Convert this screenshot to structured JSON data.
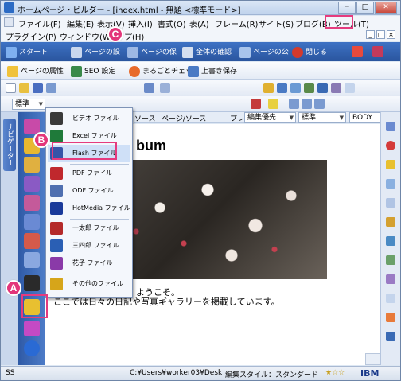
{
  "titlebar": {
    "title": "ホームページ・ビルダー - [index.html - 無題 <標準モード>]",
    "min": "─",
    "max": "□",
    "close": "✕"
  },
  "menu": {
    "row1": [
      "ファイル(F)",
      "編集(E)",
      "表示(V)",
      "挿入(I)",
      "書式(O)",
      "表(A)",
      "フレーム(R)",
      "サイト(S)",
      "ブログ(B)",
      "ツール(T)"
    ],
    "row2": [
      "プラグイン(P)",
      "ウィンドウ(W)",
      "プ(H)"
    ]
  },
  "mdi": [
    "_",
    "□",
    "×"
  ],
  "toolbar1": [
    "スタート",
    "ページの設",
    "ページの保",
    "全体の確認",
    "ページの公",
    "閉じる"
  ],
  "toolbar2": [
    "ページの属性",
    "SEO 設定",
    "まるごとチェック",
    "上書き保存"
  ],
  "toolbar3": {
    "style": "標準"
  },
  "format": {
    "bold": "B",
    "italic": "I",
    "strike": "S",
    "underline": "U"
  },
  "formatbar": {
    "style_combo": "標準",
    "priority": "編集優先",
    "font": "標準",
    "body": "BODY"
  },
  "tabs": [
    "ソース",
    "ページ/ソース",
    "プレ"
  ],
  "navtab": "ナビゲーター",
  "dropdown": {
    "items": [
      {
        "label": "ビデオ ファイル",
        "color": "#3a3a3a"
      },
      {
        "label": "Excel ファイル",
        "color": "#1f7a3a"
      },
      {
        "label": "Flash ファイル",
        "color": "#3654a8"
      },
      {
        "label": "PDF ファイル",
        "color": "#c0282d"
      },
      {
        "label": "ODF ファイル",
        "color": "#4f6fb0"
      },
      {
        "label": "HotMedia ファイル",
        "color": "#1a3a9a"
      },
      {
        "label": "一太郎 ファイル",
        "color": "#b42a2a"
      },
      {
        "label": "三四郎 ファイル",
        "color": "#2a5fb4"
      },
      {
        "label": "花子 ファイル",
        "color": "#8a3aa8"
      },
      {
        "label": "その他のファイル",
        "color": "#d6a51a"
      }
    ]
  },
  "page": {
    "heading": "bum",
    "para1": "ようこそ。",
    "para2": "ここでは日々の日記や写真ギャラリーを掲載しています。"
  },
  "status": {
    "left": "SS",
    "path": "C:¥Users¥worker03¥Desk",
    "style": "編集スタイル：スタンダード",
    "brand": "IBM",
    "rating": "★☆☆"
  },
  "callouts": {
    "a": "A",
    "b": "B",
    "c": "C"
  },
  "colors": {
    "highlight": "#e53b7e",
    "toolbar": "#2a559e",
    "panel": "#3d6ab8"
  }
}
